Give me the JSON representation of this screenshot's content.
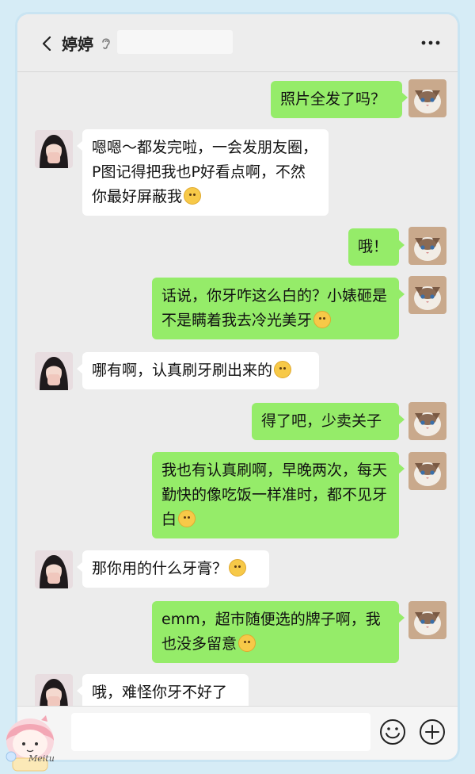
{
  "header": {
    "contact_name": "婷婷"
  },
  "messages": [
    {
      "side": "right",
      "text": "照片全发了吗？"
    },
    {
      "side": "left",
      "text": "嗯嗯～都发完啦，一会发朋友圈，P图记得把我也P好看点啊，不然你最好屏蔽我"
    },
    {
      "side": "right",
      "text": "哦！"
    },
    {
      "side": "right",
      "text": "话说，你牙咋这么白的？小婊砸是不是瞒着我去冷光美牙"
    },
    {
      "side": "left",
      "text": "哪有啊，认真刷牙刷出来的"
    },
    {
      "side": "right",
      "text": "得了吧，少卖关子"
    },
    {
      "side": "right",
      "text": "我也有认真刷啊，早晚两次，每天勤快的像吃饭一样准时，都不见牙白"
    },
    {
      "side": "left",
      "text": "那你用的什么牙膏？"
    },
    {
      "side": "right",
      "text": "emm，超市随便选的牌子啊，我也没多留意"
    },
    {
      "side": "left",
      "text": "哦，难怪你牙不好了"
    }
  ],
  "composer": {
    "placeholder": ""
  },
  "watermark": {
    "text": "Meitu"
  },
  "colors": {
    "sent_bubble": "#95ec69",
    "received_bubble": "#ffffff",
    "chat_background": "#ececec",
    "page_background": "#d6ecf6"
  },
  "icons": {
    "back": "chevron-left-icon",
    "voice": "ear-icon",
    "more": "more-dots-icon",
    "emoji": "emoji-icon",
    "plus": "plus-circle-icon"
  }
}
